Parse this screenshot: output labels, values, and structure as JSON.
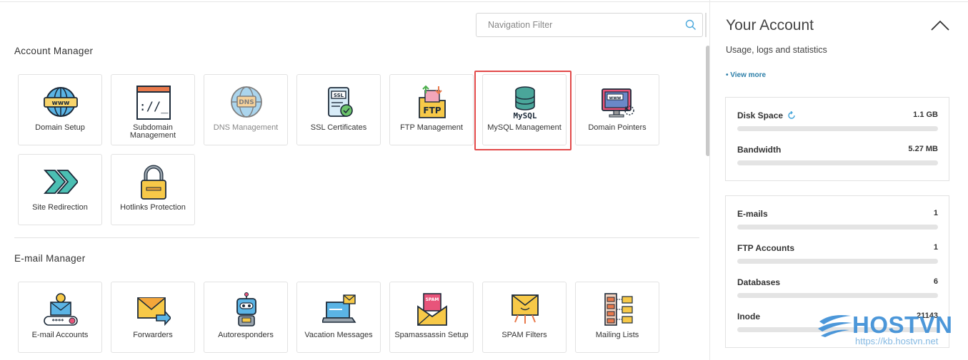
{
  "search": {
    "placeholder": "Navigation Filter",
    "icon": "search-icon"
  },
  "sections": {
    "account_manager": {
      "title": "Account Manager",
      "tiles": [
        {
          "label": "Domain Setup",
          "icon": "www-globe-icon"
        },
        {
          "label": "Subdomain Management",
          "icon": "subdomain-terminal-icon"
        },
        {
          "label": "DNS Management",
          "icon": "dns-globe-icon"
        },
        {
          "label": "SSL Certificates",
          "icon": "ssl-certificate-icon"
        },
        {
          "label": "FTP Management",
          "icon": "ftp-folder-icon"
        },
        {
          "label": "MySQL Management",
          "icon": "mysql-database-icon"
        },
        {
          "label": "Domain Pointers",
          "icon": "domain-pointer-monitor-icon"
        },
        {
          "label": "Site Redirection",
          "icon": "redirect-arrows-icon"
        },
        {
          "label": "Hotlinks Protection",
          "icon": "padlock-icon"
        }
      ]
    },
    "email_manager": {
      "title": "E-mail Manager",
      "tiles": [
        {
          "label": "E-mail Accounts",
          "icon": "email-account-icon"
        },
        {
          "label": "Forwarders",
          "icon": "envelope-forward-icon"
        },
        {
          "label": "Autoresponders",
          "icon": "robot-icon"
        },
        {
          "label": "Vacation Messages",
          "icon": "laptop-mail-icon"
        },
        {
          "label": "Spamassassin Setup",
          "icon": "spam-envelope-icon"
        },
        {
          "label": "SPAM Filters",
          "icon": "spam-filter-envelope-icon"
        },
        {
          "label": "Mailing Lists",
          "icon": "mailing-list-icon"
        }
      ]
    }
  },
  "account": {
    "title": "Your Account",
    "subtitle": "Usage, logs and statistics",
    "view_more": "• View more",
    "usage": [
      {
        "name": "Disk Space",
        "value": "1.1 GB",
        "fill": 0
      },
      {
        "name": "Bandwidth",
        "value": "5.27 MB",
        "fill": 0
      }
    ],
    "counts": [
      {
        "name": "E-mails",
        "value": "1",
        "fill": 0
      },
      {
        "name": "FTP Accounts",
        "value": "1",
        "fill": 0
      },
      {
        "name": "Databases",
        "value": "6",
        "fill": 0
      },
      {
        "name": "Inode",
        "value": "21143",
        "fill": 0
      }
    ]
  },
  "watermark": {
    "brand": "HOSTVN",
    "url": "https://kb.hostvn.net"
  },
  "colors": {
    "accent": "#2b7ea8",
    "highlight": "#e24a4a",
    "bar": "#e4e4e4",
    "brand": "#3d8fd6"
  }
}
